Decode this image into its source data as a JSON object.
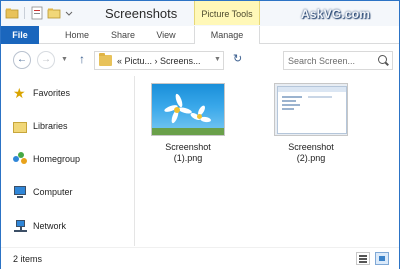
{
  "window": {
    "title": "Screenshots",
    "context_tab": "Picture Tools",
    "brand": "AskVG.com",
    "controls": {
      "minimize": "–",
      "maximize": "□",
      "close": "✕"
    },
    "help": "?"
  },
  "ribbon": {
    "tabs": [
      {
        "label": "File"
      },
      {
        "label": "Home"
      },
      {
        "label": "Share"
      },
      {
        "label": "View"
      },
      {
        "label": "Manage"
      }
    ]
  },
  "address": {
    "path_text": "« Pictu... › Screens...",
    "back": "←",
    "forward": "→",
    "up": "↑",
    "refresh": "↻",
    "search_placeholder": "Search Screen..."
  },
  "navpane": {
    "items": [
      {
        "label": "Favorites",
        "icon": "star-icon"
      },
      {
        "label": "Libraries",
        "icon": "libraries-icon"
      },
      {
        "label": "Homegroup",
        "icon": "homegroup-icon"
      },
      {
        "label": "Computer",
        "icon": "computer-icon"
      },
      {
        "label": "Network",
        "icon": "network-icon"
      }
    ]
  },
  "files": [
    {
      "name_line1": "Screenshot",
      "name_line2": "(1).png",
      "thumbnail": "daisy-wallpaper"
    },
    {
      "name_line1": "Screenshot",
      "name_line2": "(2).png",
      "thumbnail": "explorer-window"
    }
  ],
  "status": {
    "item_count": "2 items"
  },
  "colors": {
    "accent": "#1a66bd",
    "context_tab_bg": "#fff8b8",
    "window_border": "#2c73c5"
  }
}
